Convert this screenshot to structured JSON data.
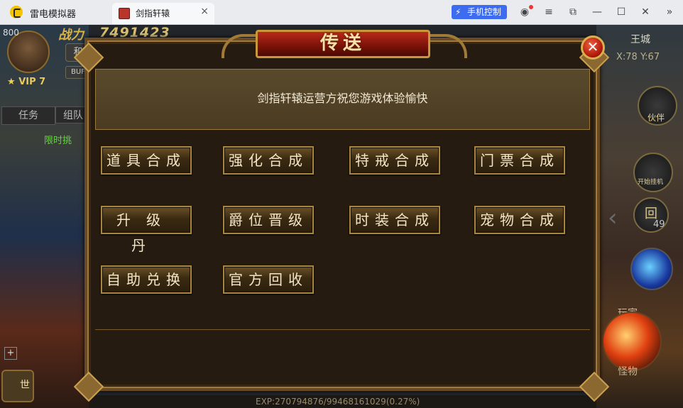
{
  "window": {
    "app_name": "雷电模拟器",
    "tab_title": "剑指轩辕",
    "tab_close": "×",
    "phone_control": "手机控制",
    "icons": [
      "user-icon",
      "menu-icon",
      "restore-icon",
      "minimize-icon",
      "maximize-icon",
      "close-icon",
      "sidebar-collapse-icon"
    ]
  },
  "hud": {
    "hp_number": "800",
    "power_label": "战力",
    "power_value": "7491423",
    "vip": "VIP 7",
    "chip_he": "和",
    "chip_buff": "BUF",
    "task_tab": "任务",
    "team_tab": "组队",
    "quest_text": "限时挑",
    "map_name": "王城",
    "coords": "X:78 Y:67",
    "partner": "伙伴",
    "auto": "开始挂机",
    "return_symbol": "回",
    "return_count": "49",
    "player_label": "玩家",
    "monster_label": "怪物",
    "voice": "世",
    "chat_add": "+",
    "exp": "EXP:270794876/99468161029(0.27%)"
  },
  "dialog": {
    "title": "传送",
    "close": "✕",
    "notice": "剑指轩辕运营方祝您游戏体验愉快",
    "buttons": {
      "item_synth": "道具合成",
      "enhance_synth": "强化合成",
      "ring_synth": "特戒合成",
      "ticket_synth": "门票合成",
      "level_pill": "升级丹",
      "rank_up": "爵位晋级",
      "fashion_synth": "时装合成",
      "pet_synth": "宠物合成",
      "self_exchange": "自助兑换",
      "official_recycle": "官方回收"
    }
  },
  "colors": {
    "dialog_bg": "#251b10",
    "dialog_border": "#a07a3a",
    "header_red": "#b72a1a",
    "button_text": "#f3e6c6",
    "accent_blue": "#3d6cf0"
  }
}
